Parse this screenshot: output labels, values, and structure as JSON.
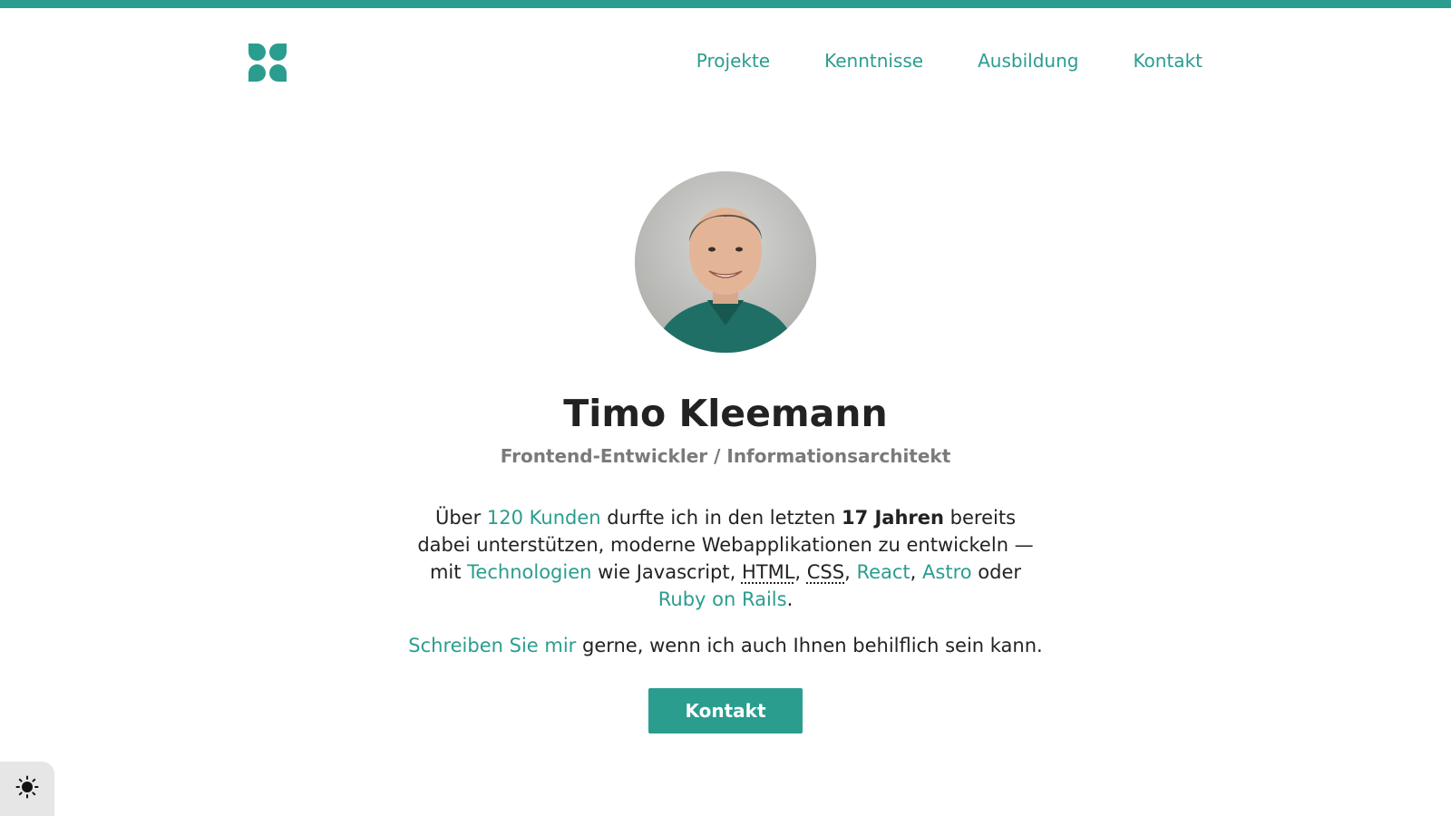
{
  "header": {
    "logo_icon": "clover-logo-icon",
    "nav": [
      "Projekte",
      "Kenntnisse",
      "Ausbildung",
      "Kontakt"
    ]
  },
  "profile": {
    "name": "Timo Kleemann",
    "subtitle": "Frontend-Entwickler / Informationsarchitekt"
  },
  "intro": {
    "prefix": "Über ",
    "link_customers": "120 Kunden",
    "mid1": " durfte ich in den letzten ",
    "bold_years": "17 Jahren",
    "mid2": " bereits dabei unterstützen, moderne Webapplikationen zu entwickeln — mit ",
    "link_tech": "Technologien",
    "mid3": " wie Javascript, ",
    "abbr_html": "HTML",
    "sep1": ", ",
    "abbr_css": "CSS",
    "sep2": ", ",
    "link_react": "React",
    "sep3": ", ",
    "link_astro": "Astro",
    "mid4": " oder ",
    "link_rails": "Ruby on Rails",
    "suffix": "."
  },
  "cta_line": {
    "link": "Schreiben Sie mir",
    "text": " gerne, wenn ich auch Ihnen behilflich sein kann."
  },
  "cta_button": "Kontakt",
  "theme_toggle_icon": "sun-icon",
  "colors": {
    "accent": "#2a9d8f",
    "text": "#222222",
    "muted": "#7a7a7a",
    "toggle_bg": "#e6e6e6"
  }
}
